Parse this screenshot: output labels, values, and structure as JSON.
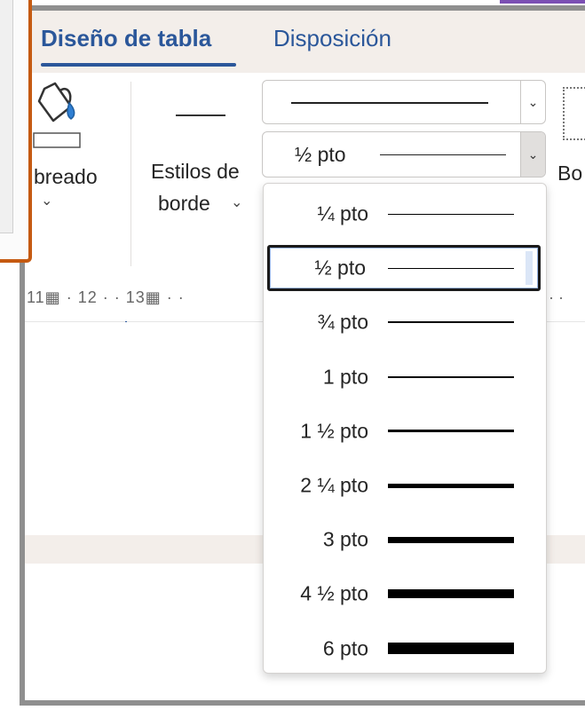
{
  "tabs": [
    {
      "label": "Diseño de tabla",
      "active": true
    },
    {
      "label": "Disposición",
      "active": false
    }
  ],
  "ribbon": {
    "shading_label": "breado",
    "border_styles_line1": "Estilos de",
    "border_styles_line2": "borde",
    "borders_label": "Bo",
    "chevron": "⌄",
    "weight_value": "½ pto"
  },
  "ruler": {
    "text": "11▦ · 12 · · 13▦ · ·",
    "right_text": "· ·"
  },
  "weights": [
    {
      "label": "¼ pto",
      "thickness_pt": 0.25
    },
    {
      "label": "½ pto",
      "thickness_pt": 0.5,
      "selected": true
    },
    {
      "label": "¾ pto",
      "thickness_pt": 0.75
    },
    {
      "label": "1 pto",
      "thickness_pt": 1
    },
    {
      "label": "1 ½ pto",
      "thickness_pt": 1.5
    },
    {
      "label": "2 ¼ pto",
      "thickness_pt": 2.25
    },
    {
      "label": "3 pto",
      "thickness_pt": 3
    },
    {
      "label": "4 ½ pto",
      "thickness_pt": 4.5
    },
    {
      "label": "6 pto",
      "thickness_pt": 6
    }
  ],
  "colors": {
    "accent": "#2b579a",
    "popup_border": "#c55a11",
    "frame": "#8f8f8f"
  }
}
